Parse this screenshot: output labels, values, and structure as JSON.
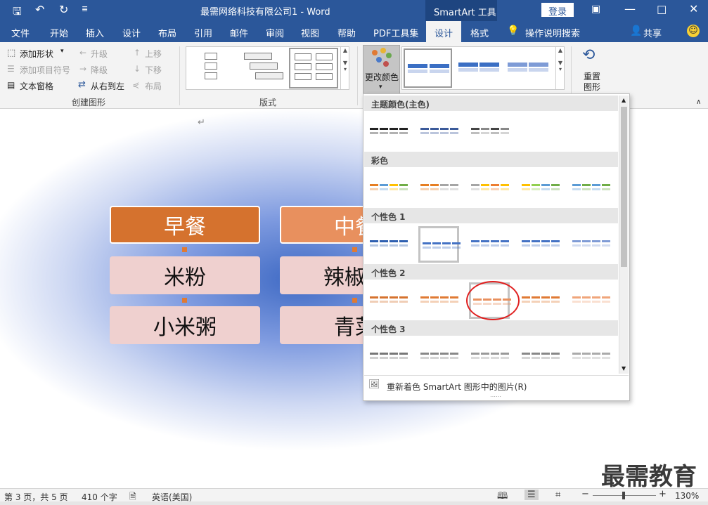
{
  "titlebar": {
    "doc_title": "最需网络科技有限公司1  -  Word",
    "context_tab": "SmartArt 工具",
    "login": "登录"
  },
  "tabs": [
    "文件",
    "开始",
    "插入",
    "设计",
    "布局",
    "引用",
    "邮件",
    "审阅",
    "视图",
    "帮助",
    "PDF工具集",
    "设计",
    "格式"
  ],
  "tell_me": "操作说明搜索",
  "share": "共享",
  "ribbon": {
    "create": {
      "add_shape": "添加形状",
      "add_bullet": "添加项目符号",
      "text_pane": "文本窗格",
      "promote": "升级",
      "demote": "降级",
      "rtl": "从右到左",
      "move_up": "上移",
      "move_down": "下移",
      "layout": "布局",
      "label": "创建图形"
    },
    "layouts": {
      "label": "版式"
    },
    "change_colors": "更改颜色",
    "reset": "重置",
    "reset2": "图形"
  },
  "smartart": {
    "col1": [
      "早餐",
      "米粉",
      "小米粥"
    ],
    "col2": [
      "中餐",
      "辣椒炒",
      "青菜"
    ]
  },
  "dropdown": {
    "sections": [
      "主题颜色(主色)",
      "彩色",
      "个性色 1",
      "个性色 2",
      "个性色 3"
    ],
    "footer": "重新着色 SmartArt 图形中的图片(R)"
  },
  "colors": {
    "blue": "#2b579a",
    "orange_dark": "#d5722e",
    "orange_light": "#e8905e",
    "pink": "#efd0cf",
    "circle": "#e02020"
  },
  "status": {
    "page": "第 3 页，共 5 页",
    "words": "410 个字",
    "lang": "英语(美国)",
    "zoom": "130%"
  },
  "watermark": "最需教育"
}
